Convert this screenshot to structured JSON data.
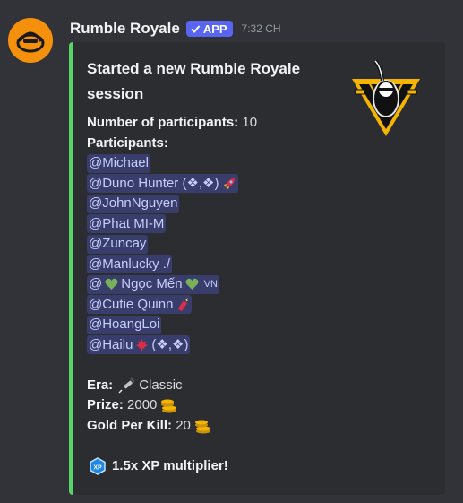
{
  "message": {
    "username": "Rumble Royale",
    "badge": "APP",
    "timestamp": "7:32 CH",
    "avatar_icon": "rumble-royale-logo-icon",
    "accent_color": "#57d466"
  },
  "embed": {
    "title": "Started a new Rumble Royale session",
    "thumbnail_icon": "rumble-royale-knight-crest-icon",
    "participant_count_label": "Number of participants:",
    "participant_count": "10",
    "participants_label": "Participants:",
    "participants": [
      {
        "name": "@Michael"
      },
      {
        "name": "@Duno Hunter (❖,❖)",
        "emoji": "rocket"
      },
      {
        "name": "@JohnNguyen"
      },
      {
        "name": "@Phat MI-M"
      },
      {
        "name": "@Zuncay"
      },
      {
        "name": "@Manlucky ./"
      },
      {
        "pre": "@",
        "emoji_pre": "green-heart",
        "name": "Ngọc Mến",
        "emoji_post": "green-heart",
        "suffix": "VN"
      },
      {
        "name": "@Cutie Quinn",
        "emoji": "firecracker"
      },
      {
        "name": "@HoangLoi"
      },
      {
        "name": "@Hailu",
        "emoji_mid": "maple-leaf",
        "suffix_text": "(❖,❖)"
      }
    ],
    "era_label": "Era:",
    "era_value": "Classic",
    "era_icon": "syringe-icon",
    "prize_label": "Prize:",
    "prize_value": "2000",
    "gold_label": "Gold Per Kill:",
    "gold_value": "20",
    "coin_icon": "gold-coins-icon",
    "xp_icon": "xp-badge-icon",
    "xp_text": "1.5x XP multiplier!"
  }
}
